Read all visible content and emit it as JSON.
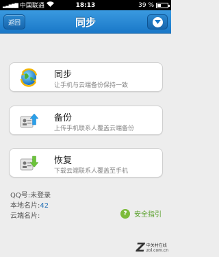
{
  "status_bar": {
    "carrier": "中国联通",
    "time": "18:13",
    "battery": "39 %",
    "battery_level": 0.39
  },
  "nav": {
    "back_label": "返回",
    "title": "同步",
    "menu_icon": "chevron-down-circle-icon"
  },
  "cards": [
    {
      "title": "同步",
      "subtitle": "让手机与云端备份保持一致",
      "icon": "globe-sync-icon"
    },
    {
      "title": "备份",
      "subtitle": "上传手机联系人覆盖云端备份",
      "icon": "upload-contact-icon"
    },
    {
      "title": "恢复",
      "subtitle": "下载云端联系人覆盖至手机",
      "icon": "download-contact-icon"
    }
  ],
  "info": {
    "qq_label": "QQ号:",
    "qq_value": "未登录",
    "local_label": "本地名片:",
    "local_value": "42",
    "cloud_label": "云端名片:",
    "cloud_value": ""
  },
  "guide": {
    "label": "安全指引",
    "icon": "security-guide-icon"
  },
  "watermark": {
    "logo": "Z",
    "text_top": "中关村在线",
    "text_bottom": "zol.com.cn"
  },
  "colors": {
    "nav_blue": "#1a78c8",
    "accent_green": "#5aa02c",
    "number_blue": "#2a74b8"
  }
}
